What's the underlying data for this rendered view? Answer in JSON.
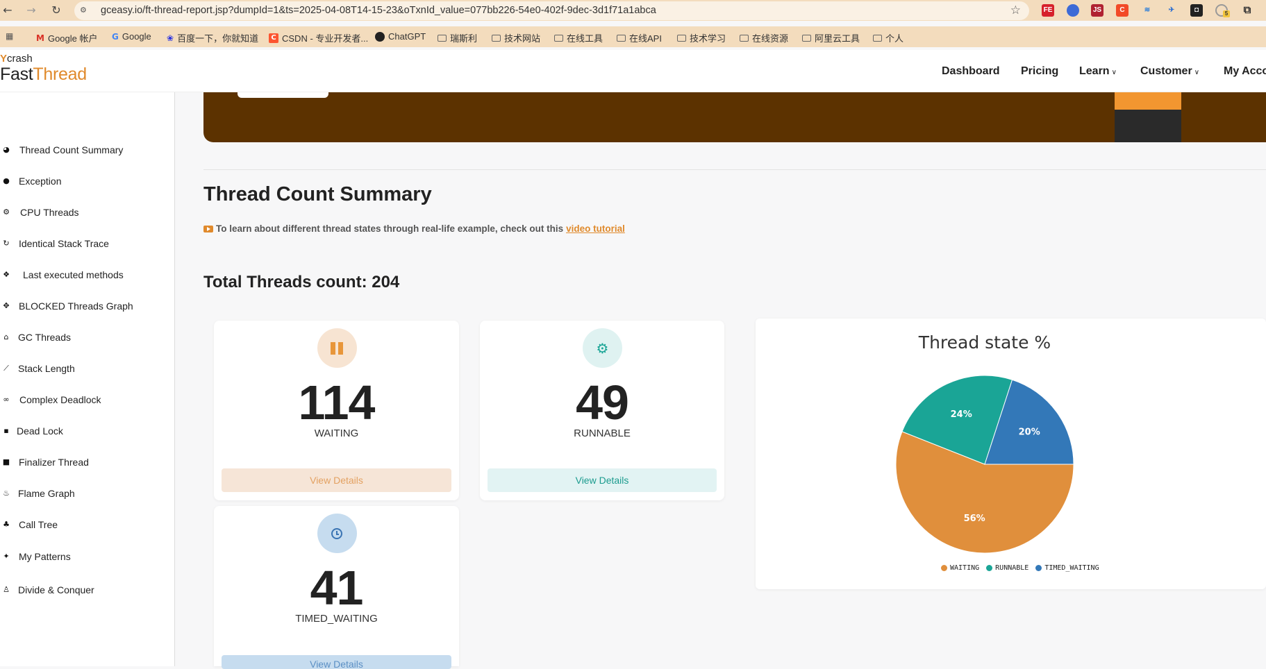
{
  "browser": {
    "url": "gceasy.io/ft-thread-report.jsp?dumpId=1&ts=2025-04-08T14-15-23&oTxnId_value=077bb226-54e0-402f-9dec-3d1f71a1abca",
    "extension_badge": "5",
    "bookmarks": [
      "Google 帐户",
      "Google",
      "百度一下，你就知道",
      "CSDN - 专业开发者...",
      "ChatGPT",
      "瑞斯利",
      "技术网站",
      "在线工具",
      "在线API",
      "技术学习",
      "在线资源",
      "阿里云工具",
      "个人"
    ]
  },
  "header": {
    "logo_small_prefix": "Y",
    "logo_small": "crash",
    "logo_main": "Fast",
    "logo_accent": "Thread",
    "nav": [
      "Dashboard",
      "Pricing",
      "Learn",
      "Customer",
      "My Acco"
    ]
  },
  "sidebar": {
    "items": [
      {
        "label": "Thread Count Summary",
        "icon": "dashboard-icon"
      },
      {
        "label": "Exception",
        "icon": "exclamation-icon"
      },
      {
        "label": "CPU Threads",
        "icon": "cogs-icon"
      },
      {
        "label": "Identical Stack Trace",
        "icon": "refresh-icon"
      },
      {
        "label": "Last executed methods",
        "icon": "cubes-icon"
      },
      {
        "label": "BLOCKED Threads Graph",
        "icon": "arrows-icon"
      },
      {
        "label": "GC Threads",
        "icon": "trash-icon"
      },
      {
        "label": "Stack Length",
        "icon": "stairs-icon"
      },
      {
        "label": "Complex Deadlock",
        "icon": "link-icon"
      },
      {
        "label": "Dead Lock",
        "icon": "lock-icon"
      },
      {
        "label": "Finalizer Thread",
        "icon": "square-icon"
      },
      {
        "label": "Flame Graph",
        "icon": "flame-icon"
      },
      {
        "label": "Call Tree",
        "icon": "tree-icon"
      },
      {
        "label": "My Patterns",
        "icon": "puzzle-icon"
      },
      {
        "label": "Divide & Conquer",
        "icon": "sitemap-icon"
      }
    ]
  },
  "main": {
    "title": "Thread Count Summary",
    "tutorial_text": "To learn about different thread states through real-life example, check out this",
    "tutorial_link": "video tutorial",
    "total_label": "Total Threads count: 204"
  },
  "cards": [
    {
      "count": "114",
      "state": "WAITING",
      "button": "View Details"
    },
    {
      "count": "49",
      "state": "RUNNABLE",
      "button": "View Details"
    },
    {
      "count": "41",
      "state": "TIMED_WAITING",
      "button": "View Details"
    }
  ],
  "colors": {
    "waiting": "#e08f3c",
    "runnable": "#1aa596",
    "timed_waiting": "#3378b8"
  },
  "chart_data": {
    "type": "pie",
    "title": "Thread state %",
    "categories": [
      "WAITING",
      "RUNNABLE",
      "TIMED_WAITING"
    ],
    "values": [
      56,
      24,
      20
    ],
    "labels": [
      "56%",
      "24%",
      "20%"
    ],
    "legend_position": "bottom"
  }
}
